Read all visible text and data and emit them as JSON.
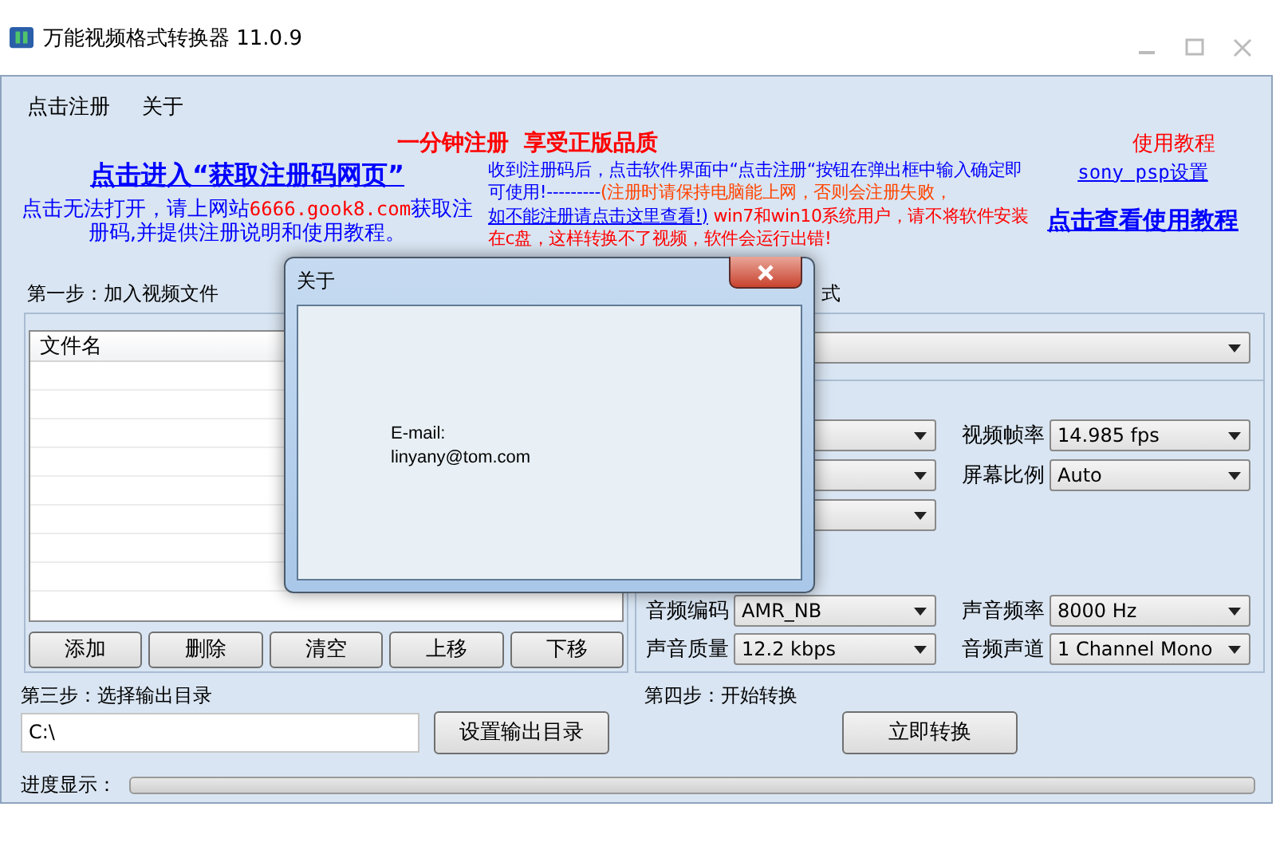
{
  "window": {
    "title": "万能视频格式转换器 11.0.9"
  },
  "menu": [
    {
      "label": "点击注册"
    },
    {
      "label": "关于"
    }
  ],
  "header": {
    "headline": "一分钟注册  享受正版品质",
    "register_link": "点击进入“获取注册码网页”",
    "register_note": [
      {
        "kind": "plain",
        "text": "点击无法打开，请上网站"
      },
      {
        "kind": "url",
        "text": "6666.gook8.com"
      },
      {
        "kind": "plain",
        "text": "获取注册码,并提供注册说明和使用教程。"
      }
    ],
    "notice": [
      {
        "kind": "blue",
        "text": "收到注册码后，点击软件界面中“点击注册“按钮在弹出框中输入确定即可使用!---------"
      },
      {
        "kind": "orange",
        "text": "(注册时请保持电脑能上网，否则会注册失败，"
      },
      {
        "kind": "link",
        "text": "如不能注册请点击这里查看!)"
      },
      {
        "kind": "red",
        "text": " win7和win10系统用户，请不将软件安装在c盘，这样转换不了视频，软件会运行出错!"
      }
    ],
    "tutorial_title": "使用教程",
    "psp_link": "sony psp设置",
    "tutorial_link": "点击查看使用教程"
  },
  "step1": {
    "label": "第一步：加入视频文件",
    "columns": [
      "文件名"
    ],
    "buttons": [
      "添加",
      "删除",
      "清空",
      "上移",
      "下移"
    ]
  },
  "step2": {
    "label_visible": "式",
    "video": [
      {
        "label": "视频帧率",
        "value": "14.985 fps"
      },
      {
        "label": "屏幕比例",
        "value": "Auto"
      }
    ],
    "audio": [
      {
        "label": "音频编码",
        "value": "AMR_NB"
      },
      {
        "label": "声音频率",
        "value": "8000 Hz"
      },
      {
        "label": "声音质量",
        "value": "12.2 kbps"
      },
      {
        "label": "音频声道",
        "value": "1 Channel Mono"
      }
    ]
  },
  "step3": {
    "label": "第三步：选择输出目录",
    "path": "C:\\",
    "button": "设置输出目录"
  },
  "step4": {
    "label": "第四步：开始转换",
    "button": "立即转换"
  },
  "progress": {
    "label": "进度显示：",
    "level": 0
  },
  "dialog": {
    "title": "关于",
    "lines": [
      "E-mail:",
      "linyany@tom.com"
    ]
  }
}
